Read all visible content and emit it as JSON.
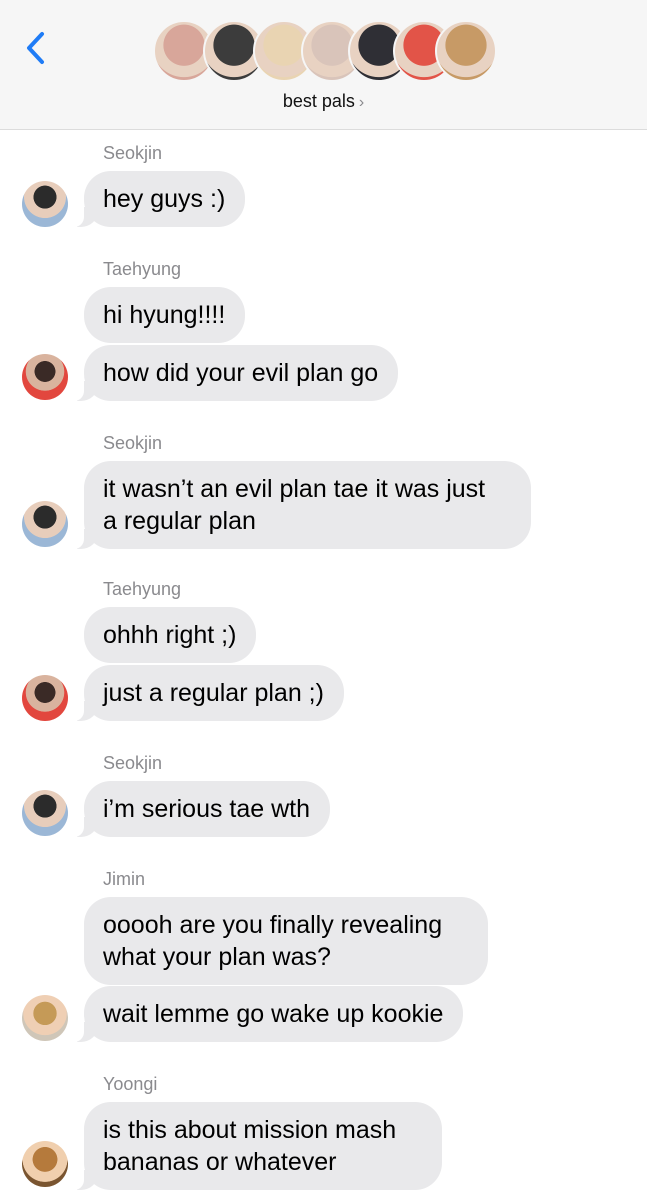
{
  "header": {
    "group_name": "best pals",
    "chevron": "›",
    "avatar_colors": [
      "#d8a69a",
      "#3c3c3c",
      "#e9d4b2",
      "#d9c4ba",
      "#2f2f35",
      "#e25448",
      "#c79a66"
    ]
  },
  "messages": [
    {
      "sender": "Seokjin",
      "avatar": "jin",
      "bubbles": [
        "hey guys :)"
      ]
    },
    {
      "sender": "Taehyung",
      "avatar": "tae",
      "bubbles": [
        "hi hyung!!!!",
        "how did your evil plan go"
      ]
    },
    {
      "sender": "Seokjin",
      "avatar": "jin",
      "bubbles": [
        "it wasn’t an evil plan tae it was just\na regular plan"
      ]
    },
    {
      "sender": "Taehyung",
      "avatar": "tae",
      "bubbles": [
        "ohhh right ;)",
        "just a regular plan ;)"
      ]
    },
    {
      "sender": "Seokjin",
      "avatar": "jin",
      "bubbles": [
        "i’m serious tae wth"
      ]
    },
    {
      "sender": "Jimin",
      "avatar": "jimin",
      "bubbles": [
        "ooooh are you finally revealing\nwhat your plan was?",
        "wait lemme go wake up kookie"
      ]
    },
    {
      "sender": "Yoongi",
      "avatar": "yoongi",
      "bubbles": [
        "is this about mission mash\nbananas or whatever"
      ]
    }
  ],
  "colors": {
    "accent": "#1f7cf6",
    "bubble_bg": "#e9e9eb",
    "header_bg": "#f6f6f6",
    "sender_text": "#8a8a8e"
  }
}
